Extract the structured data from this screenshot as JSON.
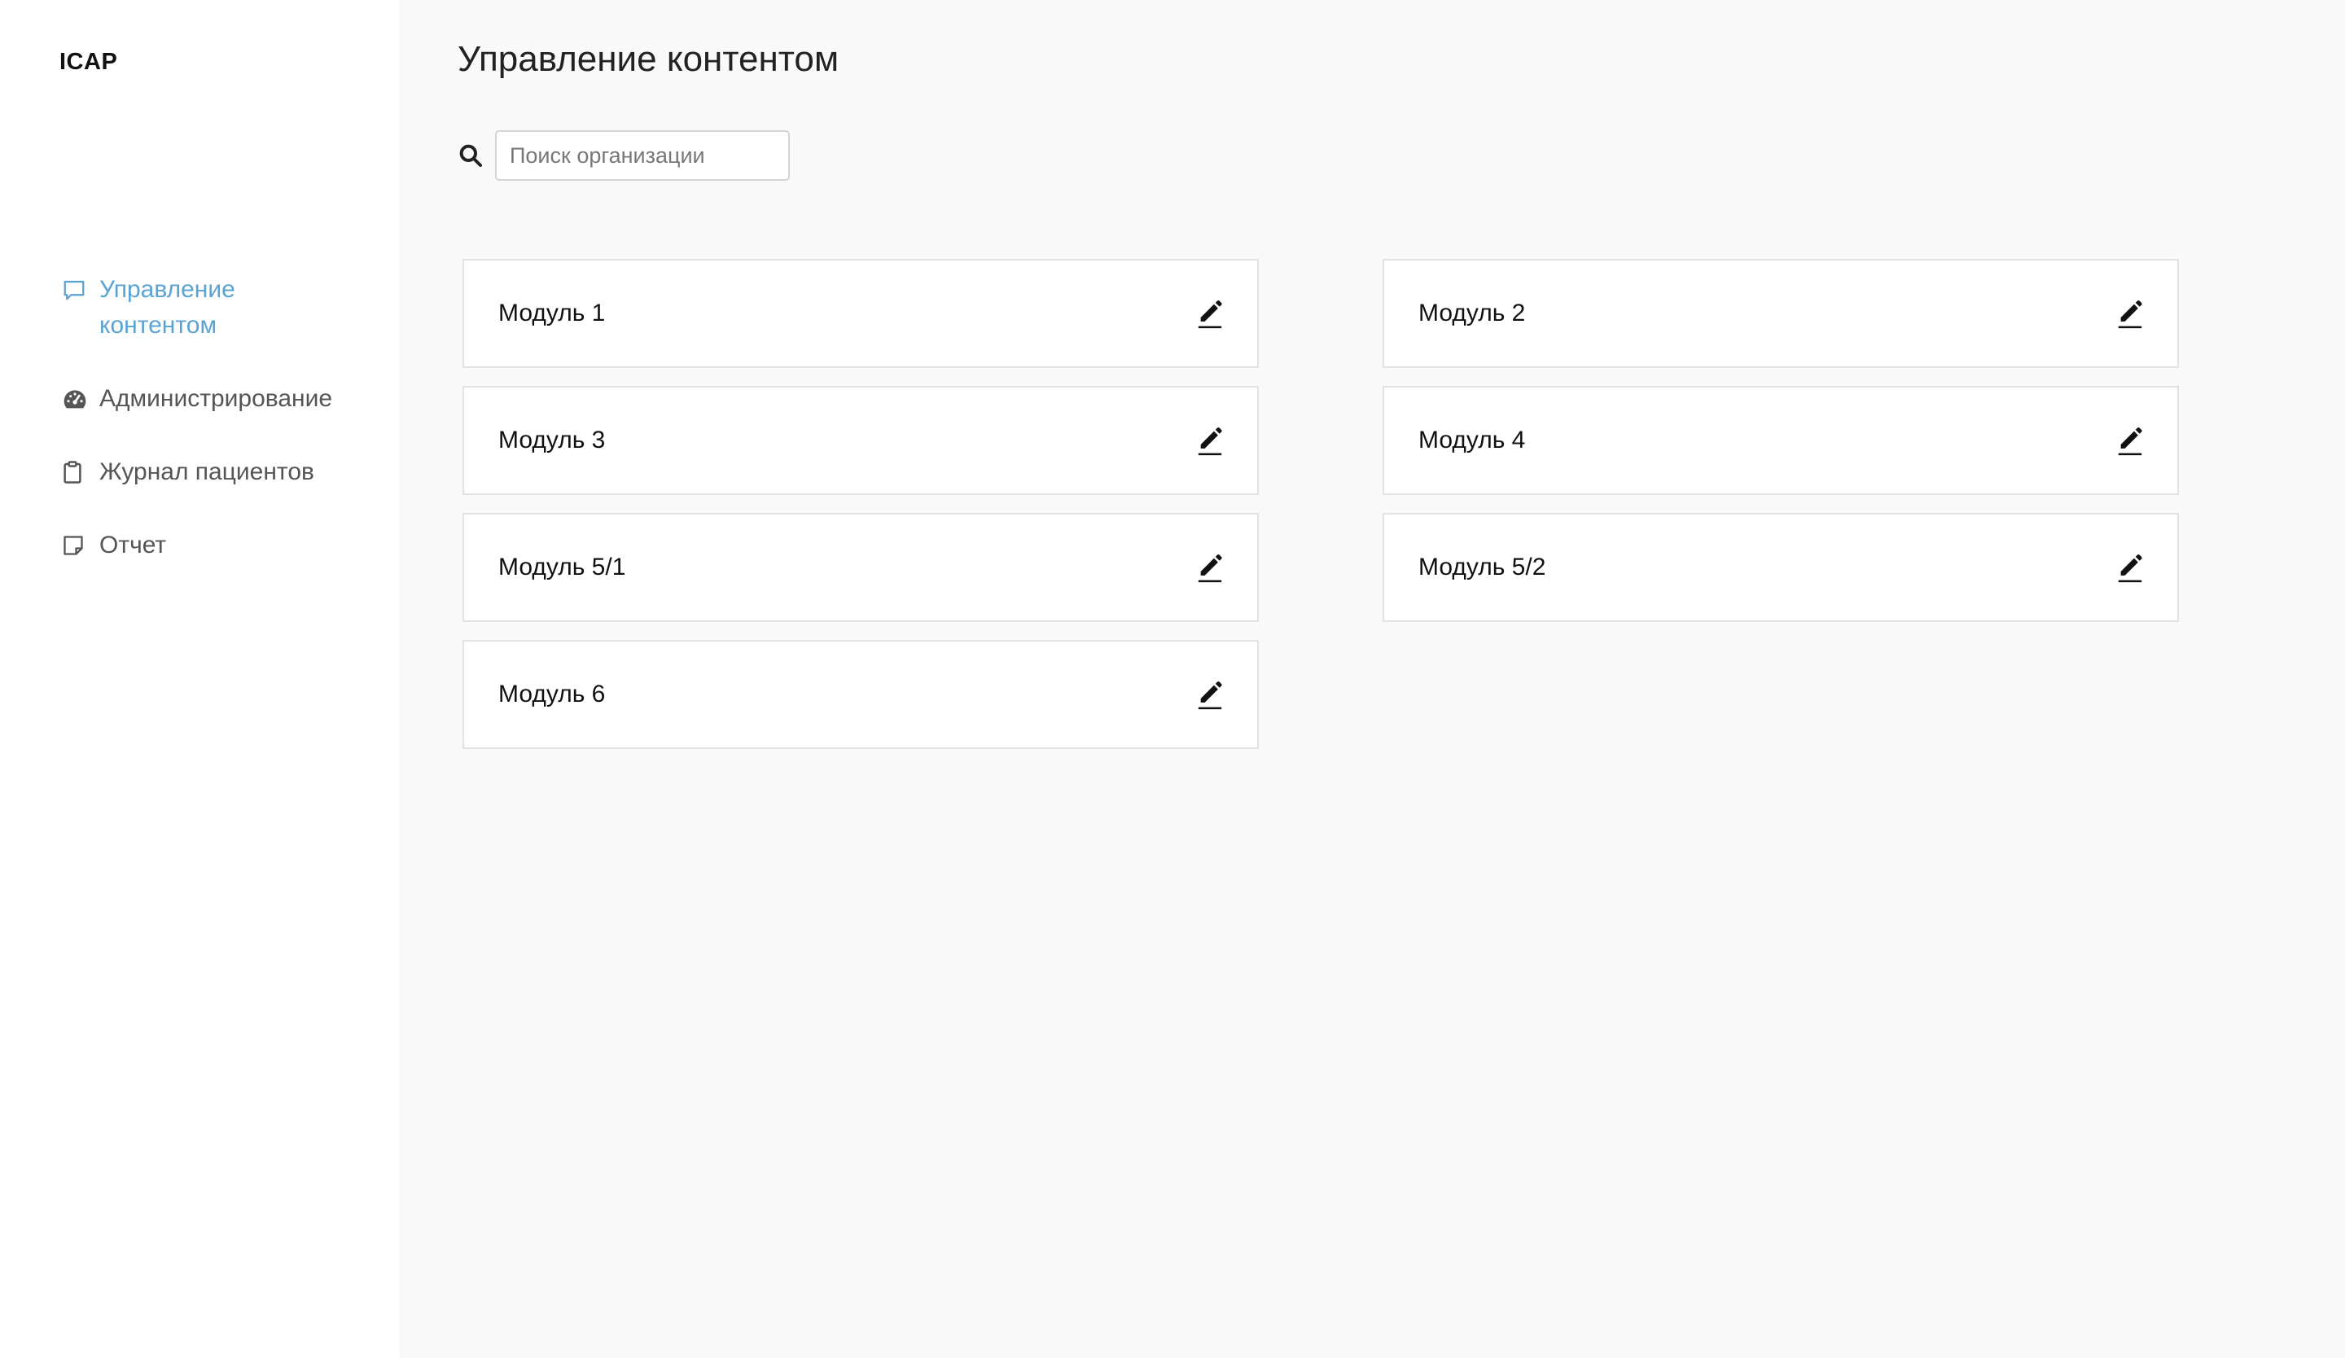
{
  "app": {
    "logo": "ICAP"
  },
  "sidebar": {
    "items": [
      {
        "label": "Управление контентом",
        "icon": "message-square-icon",
        "active": true
      },
      {
        "label": "Администрирование",
        "icon": "gauge-icon",
        "active": false
      },
      {
        "label": "Журнал пациентов",
        "icon": "clipboard-icon",
        "active": false
      },
      {
        "label": "Отчет",
        "icon": "sticky-note-icon",
        "active": false
      }
    ]
  },
  "main": {
    "title": "Управление контентом",
    "search": {
      "placeholder": "Поиск организации",
      "value": ""
    },
    "modules": [
      {
        "label": "Модуль 1"
      },
      {
        "label": "Модуль 2"
      },
      {
        "label": "Модуль 3"
      },
      {
        "label": "Модуль 4"
      },
      {
        "label": "Модуль 5/1"
      },
      {
        "label": "Модуль 5/2"
      },
      {
        "label": "Модуль 6"
      }
    ]
  },
  "colors": {
    "accent": "#5aa3d3",
    "main_bg": "#f9f9f9",
    "card_border": "#e2e2e2"
  }
}
